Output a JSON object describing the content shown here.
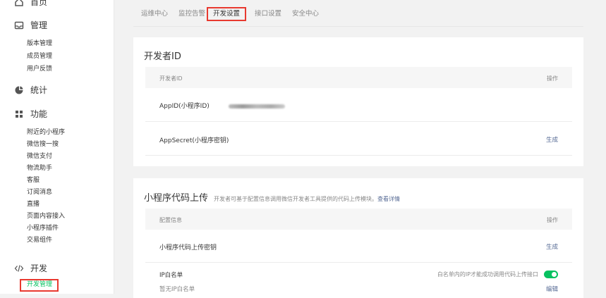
{
  "sidebar": {
    "top_partial": "首页",
    "sections": {
      "manage": "管理",
      "stats": "统计",
      "features": "功能",
      "dev": "开发"
    },
    "manage_items": [
      "版本管理",
      "成员管理",
      "用户反馈"
    ],
    "feature_items": [
      "附近的小程序",
      "微信搜一搜",
      "微信支付",
      "物流助手",
      "客服",
      "订阅消息",
      "直播",
      "页面内容接入",
      "小程序插件",
      "交易组件"
    ],
    "dev_items": [
      "开发管理"
    ]
  },
  "tabs": [
    "运维中心",
    "监控告警",
    "开发设置",
    "接口设置",
    "安全中心"
  ],
  "active_tab": "开发设置",
  "developer_id": {
    "title": "开发者ID",
    "header_left": "开发者ID",
    "header_right": "操作",
    "appid_label": "AppID(小程序ID)",
    "appsecret_label": "AppSecret(小程序密钥)",
    "appsecret_action": "生成"
  },
  "code_upload": {
    "title": "小程序代码上传",
    "subtitle": "开发者可基于配置信息调用微信开发者工具提供的代码上传模块。",
    "detail_link": "查看详情",
    "header_left": "配置信息",
    "header_right": "操作",
    "key_label": "小程序代码上传密钥",
    "key_action": "生成",
    "ip_label": "IP白名单",
    "ip_hint": "白名单内的IP才能成功调用代码上传接口",
    "ip_empty": "暂无IP白名单",
    "ip_action": "编辑",
    "toggle_on": true
  },
  "colors": {
    "accent_green": "#07c160",
    "link_blue": "#576b95",
    "highlight_red": "#e8392f"
  }
}
